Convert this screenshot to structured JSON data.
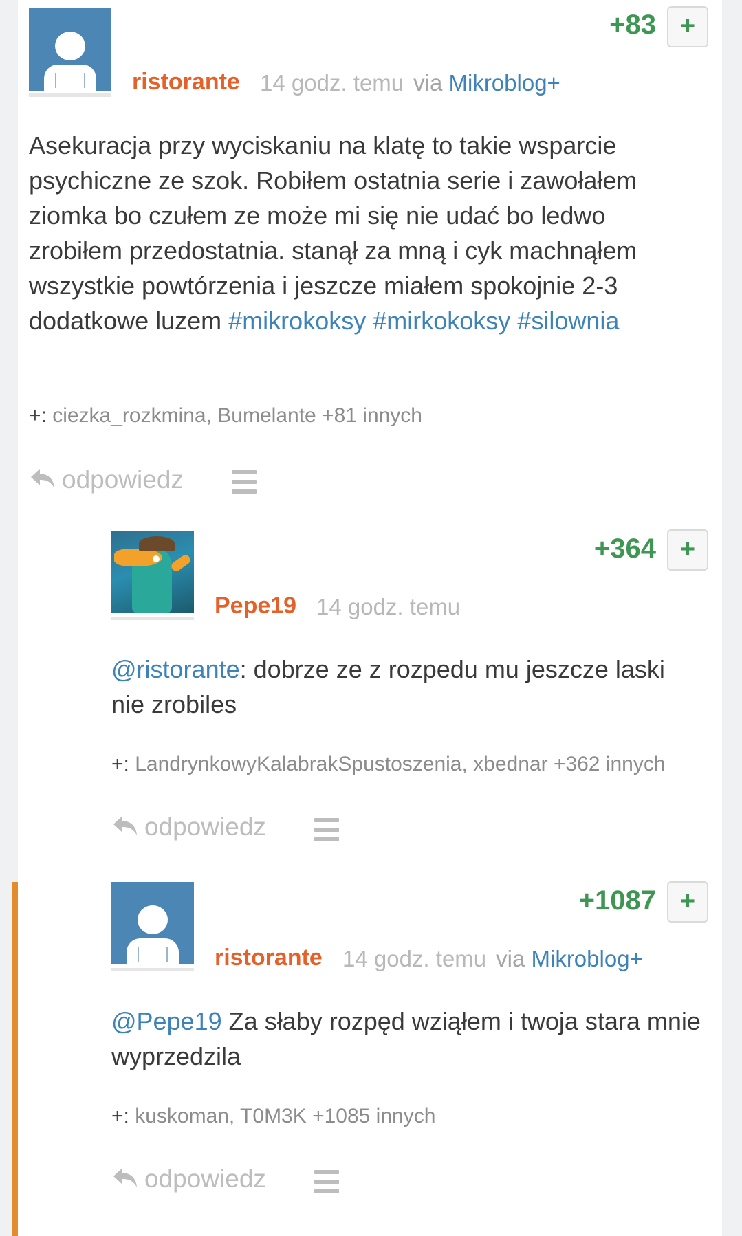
{
  "posts": [
    {
      "author": "ristorante",
      "time": "14 godz. temu",
      "via_label": "via",
      "via_app": "Mikroblog+",
      "score": "+83",
      "plus_label": "+",
      "body_parts": [
        "Asekuracja przy wyciskaniu na klatę to takie wsparcie psychiczne ze szok. Robiłem ostatnia serie i zawołałem ziomka bo czułem ze może mi się nie udać bo ledwo zrobiłem przedostatnia. stanął za mną i cyk machnąłem wszystkie powtórzenia i jeszcze miałem spokojnie 2-3 dodatkowe luzem ",
        "#mikrokoksy",
        " ",
        "#mirkokoksy",
        " ",
        "#silownia"
      ],
      "voters_lead": "+: ",
      "voters": "ciezka_rozkmina, Bumelante +81 innych",
      "reply_label": "odpowiedz"
    },
    {
      "author": "Pepe19",
      "time": "14 godz. temu",
      "score": "+364",
      "plus_label": "+",
      "mention": "@ristorante",
      "body_rest": ": dobrze ze z rozpedu mu jeszcze laski nie zrobiles",
      "voters_lead": "+: ",
      "voters": "LandrynkowyKalabrakSpustoszenia, xbednar +362 innych",
      "reply_label": "odpowiedz"
    },
    {
      "author": "ristorante",
      "time": "14 godz. temu",
      "via_label": "via",
      "via_app": "Mikroblog+",
      "score": "+1087",
      "plus_label": "+",
      "mention": "@Pepe19",
      "body_rest": " Za słaby rozpęd wziąłem i twoja stara mnie wyprzedzila",
      "voters_lead": "+: ",
      "voters": "kuskoman, T0M3K +1085 innych",
      "reply_label": "odpowiedz"
    }
  ],
  "colors": {
    "author": "#e5612a",
    "link": "#3d82b8",
    "score": "#3e9653",
    "thread_bar": "#e38b2f"
  }
}
